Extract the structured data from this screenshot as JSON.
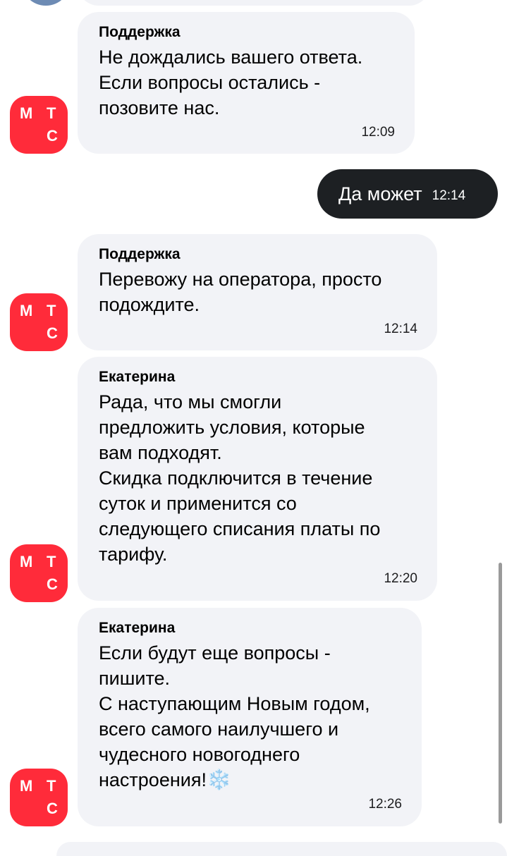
{
  "chat": {
    "messages": [
      {
        "sender": "Поддержка",
        "text": "Не дождались вашего ответа.\nЕсли вопросы остались -\nпозовите нас.",
        "time": "12:09"
      },
      {
        "text": "Да может",
        "time": "12:14"
      },
      {
        "sender": "Поддержка",
        "text": "Перевожу на оператора, просто\nподождите.",
        "time": "12:14"
      },
      {
        "sender": "Екатерина",
        "text": "Рада, что мы смогли\nпредложить условия, которые\nвам подходят.\nСкидка подключится в течение\nсуток и применится со\nследующего списания платы по\nтарифу.",
        "time": "12:20"
      },
      {
        "sender": "Екатерина",
        "text": "Если будут еще вопросы -\nпишите.\nС наступающим Новым годом,\nвсего самого наилучшего и\nчудесного новогоднего\nнастроения!",
        "emoji": "❄️",
        "time": "12:26"
      }
    ]
  },
  "avatar": {
    "letters": [
      "М",
      "Т",
      "С"
    ],
    "color": "#ff2b3a"
  },
  "colors": {
    "incoming_bubble": "#f2f3f7",
    "outgoing_bubble": "#1d2023"
  }
}
